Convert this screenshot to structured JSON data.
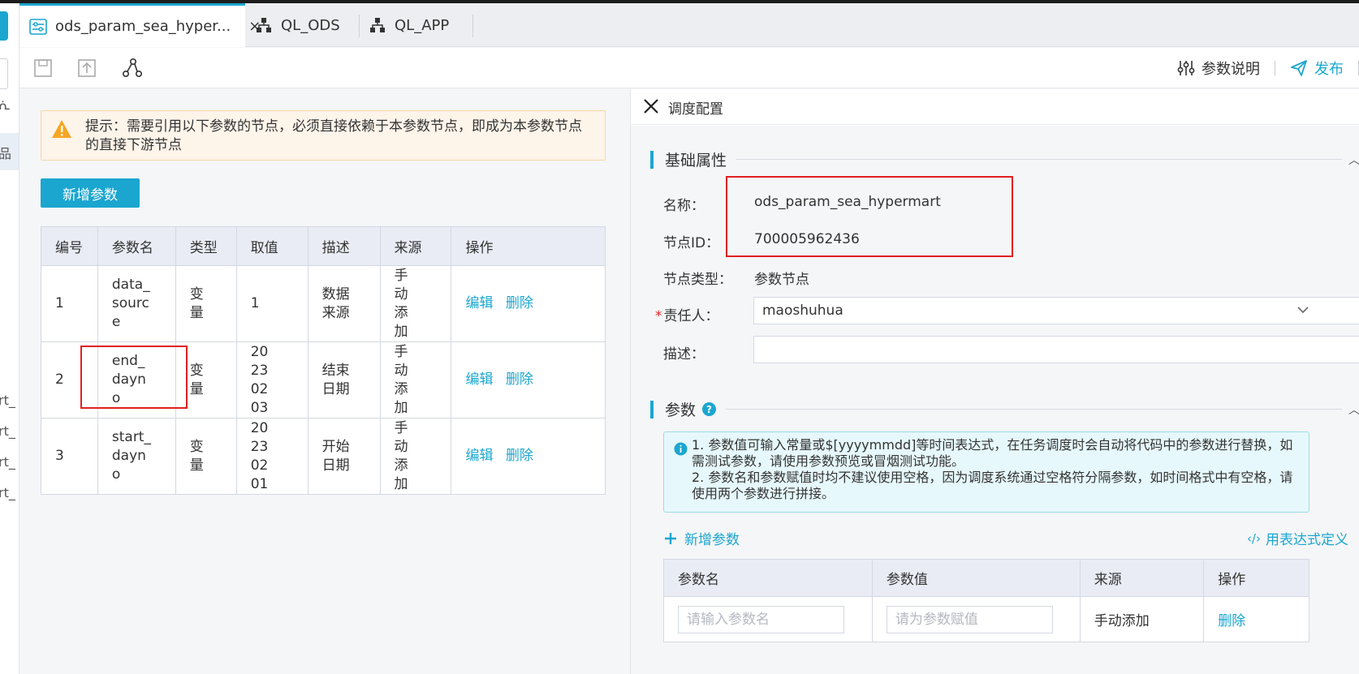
{
  "left_edge": {
    "glyphs": [
      "ᕇ",
      "品",
      "rt_",
      "rt_",
      "rt_",
      "rt_"
    ]
  },
  "tabs": [
    {
      "label": "ods_param_sea_hyper...",
      "active": true
    },
    {
      "label": "QL_ODS",
      "active": false
    },
    {
      "label": "QL_APP",
      "active": false
    }
  ],
  "toolbar": {
    "param_doc": "参数说明",
    "publish": "发布"
  },
  "notice": {
    "text": "提示：需要引用以下参数的节点，必须直接依赖于本参数节点，即成为本参数节点的直接下游节点"
  },
  "add_param_button": "新增参数",
  "param_table": {
    "headers": [
      "编号",
      "参数名",
      "类型",
      "取值",
      "描述",
      "来源",
      "操作"
    ],
    "rows": [
      {
        "no": "1",
        "name": "data_source",
        "type": "变量",
        "value": "1",
        "desc": "数据来源",
        "source": "手动添加"
      },
      {
        "no": "2",
        "name": "end_dayno",
        "type": "变量",
        "value": "20230203",
        "desc": "结束日期",
        "source": "手动添加"
      },
      {
        "no": "3",
        "name": "start_dayno",
        "type": "变量",
        "value": "20230201",
        "desc": "开始日期",
        "source": "手动添加"
      }
    ],
    "edit": "编辑",
    "delete": "删除"
  },
  "schedule": {
    "title": "调度配置",
    "basic": {
      "title": "基础属性",
      "name_label": "名称：",
      "name_value": "ods_param_sea_hypermart",
      "id_label": "节点ID：",
      "id_value": "700005962436",
      "type_label": "节点类型：",
      "type_value": "参数节点",
      "owner_label": "责任人：",
      "owner_value": "maoshuhua",
      "desc_label": "描述："
    },
    "params": {
      "title": "参数",
      "info_line1": "1. 参数值可输入常量或$[yyyymmdd]等时间表达式，在任务调度时会自动将代码中的参数进行替换，如需测试参数，请使用参数预览或冒烟测试功能。",
      "info_line2": "2. 参数名和参数赋值时均不建议使用空格，因为调度系统通过空格符分隔参数，如时间格式中有空格，请使用两个参数进行拼接。",
      "add": "新增参数",
      "expr": "用表达式定义",
      "headers": [
        "参数名",
        "参数值",
        "来源",
        "操作"
      ],
      "row": {
        "name_placeholder": "请输入参数名",
        "value_placeholder": "请为参数赋值",
        "source": "手动添加",
        "delete": "删除"
      }
    }
  },
  "colors": {
    "accent": "#1ba6cf",
    "highlight_box": "#e02020",
    "warning": "#f5a623"
  }
}
